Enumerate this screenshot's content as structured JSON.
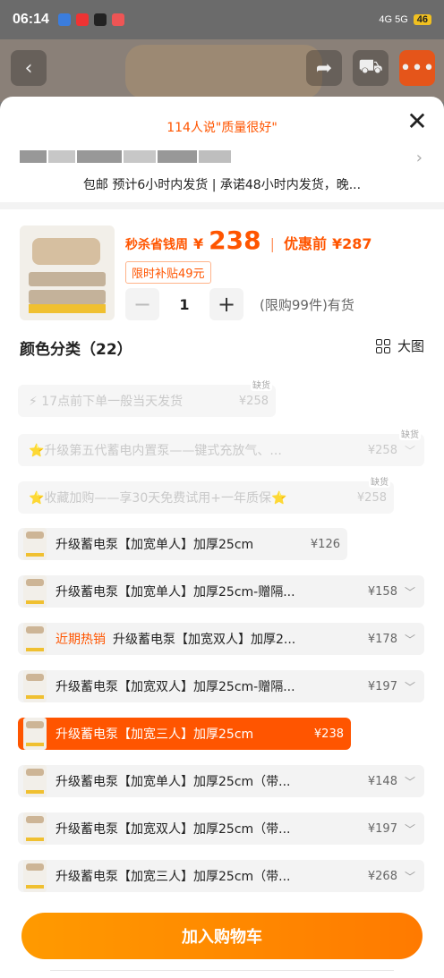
{
  "status_bar": {
    "time": "06:14",
    "network": "4G 5G",
    "battery": "46"
  },
  "sheet": {
    "review_summary": "114人说\"质量很好\"",
    "shipping": "包邮 预计6小时内发货 | 承诺48小时内发货，晚..."
  },
  "product": {
    "price_label": "秒杀省钱周",
    "currency": "¥",
    "price": "238",
    "original_label": "优惠前",
    "original_price": "¥287",
    "subsidy": "限时补贴49元",
    "quantity": "1",
    "stock_note": "(限购99件)有货"
  },
  "section": {
    "title": "颜色分类（22）",
    "big_view": "大图"
  },
  "options": [
    {
      "text": "⚡ 17点前下单一般当天发货",
      "price": "¥258",
      "badge": "缺货"
    },
    {
      "text": "⭐升级第五代蓄电内置泵——键式充放气、...",
      "price": "¥258",
      "badge": "缺货"
    },
    {
      "text": "⭐收藏加购——享30天免费试用+一年质保⭐",
      "price": "¥258",
      "badge": "缺货"
    },
    {
      "text": "升级蓄电泵【加宽单人】加厚25cm",
      "price": "¥126"
    },
    {
      "text": "升级蓄电泵【加宽单人】加厚25cm-赠隔...",
      "price": "¥158"
    },
    {
      "hot": "近期热销",
      "text": "升级蓄电泵【加宽双人】加厚2...",
      "price": "¥178"
    },
    {
      "text": "升级蓄电泵【加宽双人】加厚25cm-赠隔...",
      "price": "¥197"
    },
    {
      "text": "升级蓄电泵【加宽三人】加厚25cm",
      "price": "¥238"
    },
    {
      "text": "升级蓄电泵【加宽单人】加厚25cm（带...",
      "price": "¥148"
    },
    {
      "text": "升级蓄电泵【加宽双人】加厚25cm（带...",
      "price": "¥197"
    },
    {
      "text": "升级蓄电泵【加宽三人】加厚25cm（带...",
      "price": "¥268"
    }
  ],
  "cart_button": "加入购物车",
  "colors": {
    "accent": "#ff5500",
    "cart": "#ff8c00"
  }
}
